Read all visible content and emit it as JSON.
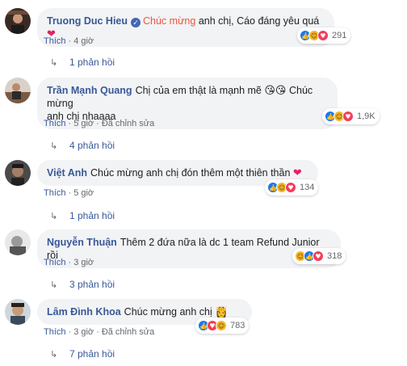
{
  "comments": [
    {
      "author": "Truong Duc Hieu",
      "verified": true,
      "tag": "Chúc mừng",
      "text": "anh chị, Cáo đáng yêu quá",
      "emoji": "❤",
      "reaction_count": "291",
      "reaction_types": [
        "like-icon",
        "haha-icon",
        "love-icon"
      ],
      "like_label": "Thích",
      "time": "4 giờ",
      "edited": "",
      "replies": "1 phản hồi"
    },
    {
      "author": "Trần Mạnh Quang",
      "verified": false,
      "tag": "",
      "text": "Chị của em thật là mạnh mẽ",
      "emoji": "😘😘",
      "text2": "Chúc mừng",
      "text_line2": "anh chị nhaaaa",
      "reaction_count": "1,9K",
      "reaction_types": [
        "like-icon",
        "haha-icon",
        "love-icon"
      ],
      "like_label": "Thích",
      "time": "5 giờ",
      "edited": "Đã chỉnh sửa",
      "replies": "4 phản hồi"
    },
    {
      "author": "Việt Anh",
      "verified": false,
      "tag": "",
      "text": "Chúc mừng anh chị đón thêm một thiên thần",
      "emoji": "❤",
      "reaction_count": "134",
      "reaction_types": [
        "like-icon",
        "haha-icon",
        "love-icon"
      ],
      "like_label": "Thích",
      "time": "5 giờ",
      "edited": "",
      "replies": "1 phản hồi"
    },
    {
      "author": "Nguyễn Thuận",
      "verified": false,
      "tag": "",
      "text": "Thêm 2 đứa nữa là dc 1 team Refund Junior rồi",
      "emoji": "",
      "reaction_count": "318",
      "reaction_types": [
        "haha-icon",
        "like-icon",
        "love-icon"
      ],
      "like_label": "Thích",
      "time": "3 giờ",
      "edited": "",
      "replies": "3 phản hồi"
    },
    {
      "author": "Lâm Đình Khoa",
      "verified": false,
      "tag": "",
      "text": "Chúc mừng anh chị",
      "emoji": "👸",
      "reaction_count": "783",
      "reaction_types": [
        "like-icon",
        "love-icon",
        "haha-icon"
      ],
      "like_label": "Thích",
      "time": "3 giờ",
      "edited": "Đã chỉnh sửa",
      "replies": "7 phản hồi"
    }
  ],
  "colors": {
    "author": "#385898",
    "tag": "#e9573f",
    "bubble": "#f2f3f5",
    "meta": "#65676b",
    "like": "#1877f2",
    "haha": "#f7b928",
    "love": "#f33e58"
  }
}
